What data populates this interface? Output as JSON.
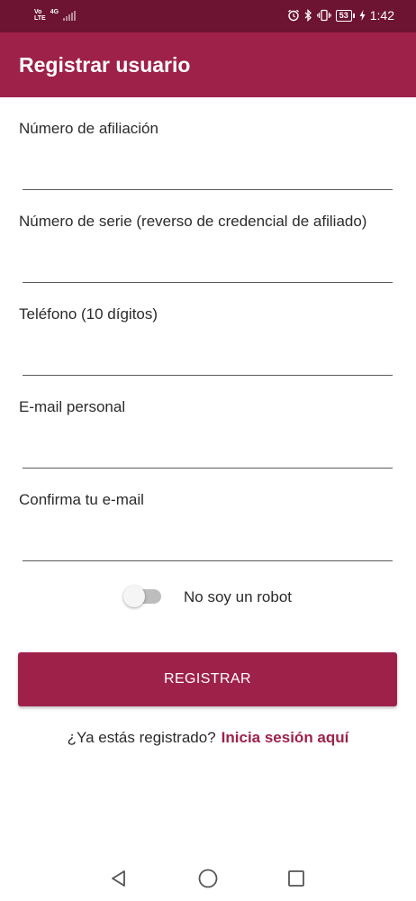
{
  "status_bar": {
    "volte_top": "Vo",
    "volte_bottom": "LTE",
    "network": "4G",
    "battery": "53",
    "time": "1:42",
    "icons": [
      "alarm-icon",
      "bluetooth-icon",
      "vibrate-icon",
      "battery-icon",
      "charging-icon"
    ]
  },
  "app_bar": {
    "title": "Registrar usuario",
    "color": "#9e2149"
  },
  "form": {
    "fields": [
      {
        "label": "Número de afiliación",
        "value": ""
      },
      {
        "label": "Número de serie (reverso de credencial de afiliado)",
        "value": ""
      },
      {
        "label": "Teléfono (10 dígitos)",
        "value": ""
      },
      {
        "label": "E-mail personal",
        "value": ""
      },
      {
        "label": "Confirma tu e-mail",
        "value": ""
      }
    ],
    "robot_toggle": {
      "label": "No soy un robot",
      "checked": false
    },
    "submit_label": "REGISTRAR"
  },
  "login_prompt": {
    "question": "¿Ya estás registrado?",
    "link": "Inicia sesión aquí"
  },
  "nav_bar": {
    "icons": [
      "back-icon",
      "home-icon",
      "recents-icon"
    ]
  },
  "colors": {
    "status_bar": "#6d1432",
    "accent": "#9e2149"
  }
}
